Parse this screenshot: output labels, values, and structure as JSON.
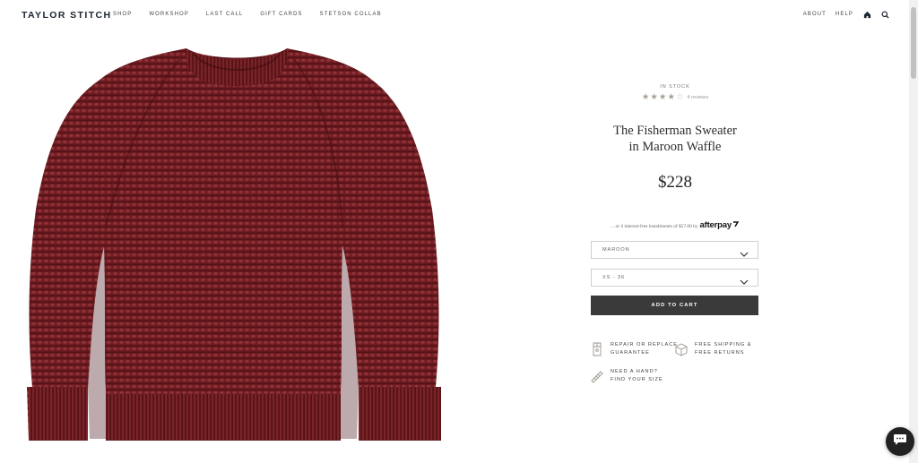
{
  "header": {
    "logo": "TAYLOR STITCH",
    "nav": [
      "SHOP",
      "WORKSHOP",
      "LAST CALL",
      "GIFT CARDS",
      "STETSON COLLAB"
    ],
    "utility": {
      "about": "ABOUT",
      "help": "HELP"
    },
    "icons": [
      "home-icon",
      "search-icon"
    ]
  },
  "product": {
    "stock": "IN STOCK",
    "rating": 4,
    "rating_max": 5,
    "reviews": "4 reviews",
    "title_line1": "The Fisherman Sweater",
    "title_line2": "in Maroon Waffle",
    "price": "$228",
    "afterpay_text": "... or 4 interest-free installments of $57.00 by",
    "afterpay_brand": "afterpay",
    "color_select": "MAROON",
    "size_select": "XS - 36",
    "add_to_cart": "ADD TO CART",
    "image_color": "#6b1a1f"
  },
  "perks": {
    "repair": {
      "line1": "REPAIR OR REPLACE",
      "line2": "GUARANTEE",
      "icon": "shirt-tag-icon"
    },
    "shipping": {
      "line1": "FREE SHIPPING &",
      "line2": "FREE RETURNS",
      "icon": "box-icon"
    },
    "size": {
      "line1": "NEED A HAND?",
      "line2": "FIND YOUR SIZE",
      "icon": "ruler-icon"
    }
  },
  "chat": {
    "icon": "chat-icon"
  }
}
